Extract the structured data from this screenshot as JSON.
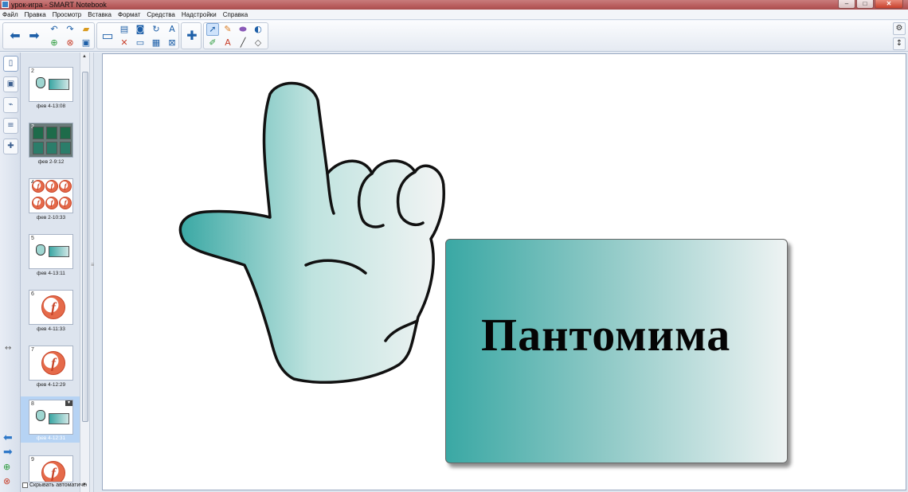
{
  "window": {
    "title": "урок-игра - SMART Notebook",
    "buttons": [
      "–",
      "□",
      "✕"
    ]
  },
  "menu": [
    "Файл",
    "Правка",
    "Просмотр",
    "Вставка",
    "Формат",
    "Средства",
    "Надстройки",
    "Справка"
  ],
  "toolbar": {
    "icons": [
      "back-icon",
      "forward-icon",
      "undo-icon",
      "redo-icon",
      "open-icon",
      "save-icon",
      "screen-icon",
      "add-page-icon",
      "capture-icon",
      "delete-icon",
      "table-icon",
      "screen-shade-icon",
      "pen-icon",
      "select-icon",
      "eraser-icon",
      "fill-icon",
      "text-icon",
      "line-icon",
      "shape-icon",
      "magic-pen-icon",
      "settings-icon",
      "move-toolbar-icon"
    ]
  },
  "sidebar": {
    "autohide_label": "Скрывать автоматически",
    "pages": [
      {
        "num": "2",
        "label": "фев 4-13:08",
        "kind": "hand"
      },
      {
        "num": "3",
        "label": "фев 2-9:12",
        "kind": "grid"
      },
      {
        "num": "4",
        "label": "фев 2-10:33",
        "kind": "logos"
      },
      {
        "num": "5",
        "label": "фев 4-13:11",
        "kind": "hand"
      },
      {
        "num": "6",
        "label": "фев 4-11:33",
        "kind": "logo"
      },
      {
        "num": "7",
        "label": "фев 4-12:29",
        "kind": "logo"
      },
      {
        "num": "8",
        "label": "фев 4-12:31",
        "kind": "hand",
        "selected": true
      },
      {
        "num": "9",
        "label": "",
        "kind": "logo"
      }
    ]
  },
  "slide": {
    "card_text": "Пантомима",
    "colors": {
      "teal": "#3aa8a4",
      "light": "#eef3f3",
      "hand_fill": "#a9dcd7",
      "outline": "#111111"
    }
  }
}
